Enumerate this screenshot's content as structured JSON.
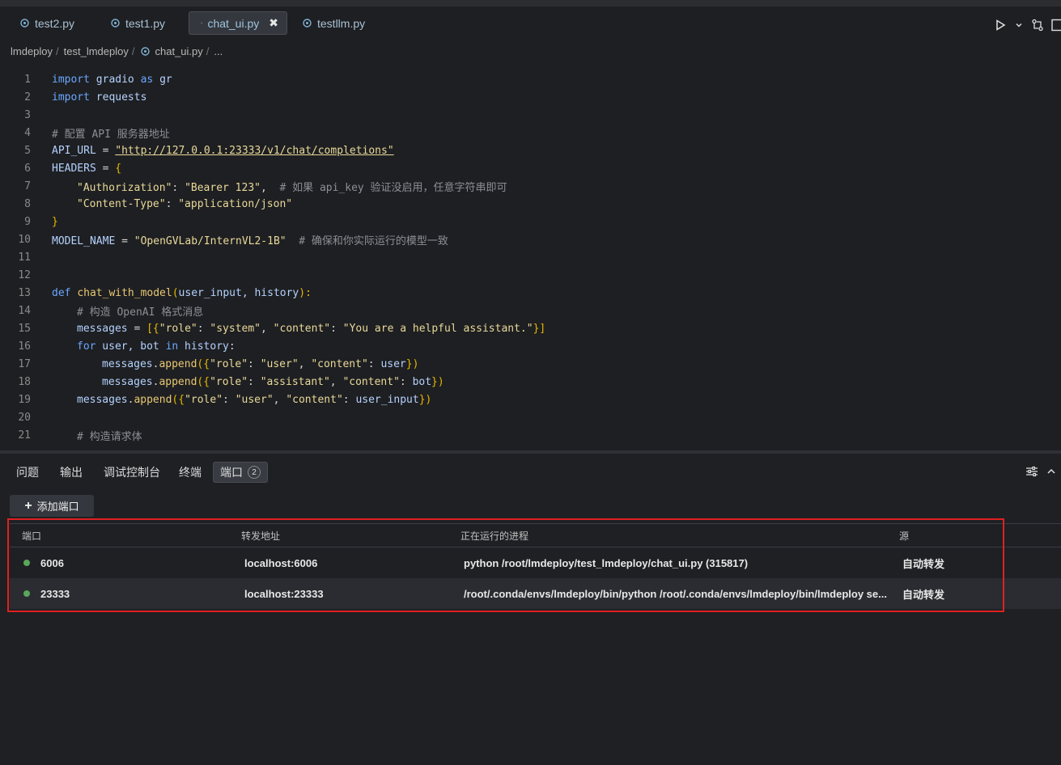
{
  "tabs": [
    {
      "label": "test2.py",
      "active": false
    },
    {
      "label": "test1.py",
      "active": false
    },
    {
      "label": "chat_ui.py",
      "active": true
    },
    {
      "label": "testllm.py",
      "active": false
    }
  ],
  "tab_close_glyph": "✖",
  "breadcrumb": [
    "lmdeploy",
    "test_lmdeploy",
    "chat_ui.py",
    "..."
  ],
  "code_lines": [
    {
      "n": "1"
    },
    {
      "n": "2"
    },
    {
      "n": "3"
    },
    {
      "n": "4"
    },
    {
      "n": "5"
    },
    {
      "n": "6"
    },
    {
      "n": "7"
    },
    {
      "n": "8"
    },
    {
      "n": "9"
    },
    {
      "n": "10"
    },
    {
      "n": "11"
    },
    {
      "n": "12"
    },
    {
      "n": "13"
    },
    {
      "n": "14"
    },
    {
      "n": "15"
    },
    {
      "n": "16"
    },
    {
      "n": "17"
    },
    {
      "n": "18"
    },
    {
      "n": "19"
    },
    {
      "n": "20"
    },
    {
      "n": "21"
    }
  ],
  "code": {
    "l1_kw": "import",
    "l1_mod": "gradio",
    "l1_as": "as",
    "l1_alias": "gr",
    "l2_kw": "import",
    "l2_mod": "requests",
    "l4_cmt": "# 配置 API 服务器地址",
    "l5_var": "API_URL",
    "l5_eq": " = ",
    "l5_str": "\"http://127.0.0.1:23333/v1/chat/completions\"",
    "l6_var": "HEADERS",
    "l6_eq": " = ",
    "l6_brace": "{",
    "l7_key": "\"Authorization\"",
    "l7_colon": ": ",
    "l7_val": "\"Bearer 123\"",
    "l7_comma": ",  ",
    "l7_cmt": "# 如果 api_key 验证没启用，任意字符串即可",
    "l8_key": "\"Content-Type\"",
    "l8_colon": ": ",
    "l8_val": "\"application/json\"",
    "l9_brace": "}",
    "l10_var": "MODEL_NAME",
    "l10_eq": " = ",
    "l10_str": "\"OpenGVLab/InternVL2-1B\"",
    "l10_cmt": "  # 确保和你实际运行的模型一致",
    "l13_def": "def",
    "l13_fn": "chat_with_model",
    "l13_open": "(",
    "l13_params": "user_input, history",
    "l13_close": "):",
    "l14_cmt": "# 构造 OpenAI 格式消息",
    "l15_var": "messages",
    "l15_eq": " = ",
    "l15_open": "[{",
    "l15_k1": "\"role\"",
    "l15_c1": ": ",
    "l15_v1": "\"system\"",
    "l15_sep": ", ",
    "l15_k2": "\"content\"",
    "l15_c2": ": ",
    "l15_v2": "\"You are a helpful assistant.\"",
    "l15_close": "}]",
    "l16_for": "for",
    "l16_vars": " user, bot ",
    "l16_in": "in",
    "l16_iter": " history",
    "l16_colon": ":",
    "l17_obj": "messages",
    "l17_dot": ".",
    "l17_fn": "append",
    "l17_open": "({",
    "l17_k1": "\"role\"",
    "l17_c1": ": ",
    "l17_v1": "\"user\"",
    "l17_sep": ", ",
    "l17_k2": "\"content\"",
    "l17_c2": ": ",
    "l17_v2": "user",
    "l17_close": "})",
    "l18_obj": "messages",
    "l18_dot": ".",
    "l18_fn": "append",
    "l18_open": "({",
    "l18_k1": "\"role\"",
    "l18_c1": ": ",
    "l18_v1": "\"assistant\"",
    "l18_sep": ", ",
    "l18_k2": "\"content\"",
    "l18_c2": ": ",
    "l18_v2": "bot",
    "l18_close": "})",
    "l19_obj": "messages",
    "l19_dot": ".",
    "l19_fn": "append",
    "l19_open": "({",
    "l19_k1": "\"role\"",
    "l19_c1": ": ",
    "l19_v1": "\"user\"",
    "l19_sep": ", ",
    "l19_k2": "\"content\"",
    "l19_c2": ": ",
    "l19_v2": "user_input",
    "l19_close": "})",
    "l21_cmt": "# 构造请求体"
  },
  "panel": {
    "tabs": [
      {
        "label": "问题"
      },
      {
        "label": "输出"
      },
      {
        "label": "调试控制台"
      },
      {
        "label": "终端"
      },
      {
        "label": "端口",
        "badge": "2"
      }
    ],
    "add_port_label": "添加端口",
    "table": {
      "headers": [
        "端口",
        "转发地址",
        "正在运行的进程",
        "源"
      ],
      "rows": [
        {
          "port": "6006",
          "address": "localhost:6006",
          "process": "python /root/lmdeploy/test_lmdeploy/chat_ui.py (315817)",
          "source": "自动转发"
        },
        {
          "port": "23333",
          "address": "localhost:23333",
          "process": "/root/.conda/envs/lmdeploy/bin/python /root/.conda/envs/lmdeploy/bin/lmdeploy se...",
          "source": "自动转发"
        }
      ]
    }
  },
  "colors": {
    "accent": "#9fc4df",
    "status_green": "#5aa65a",
    "highlight_red": "#e02020"
  }
}
